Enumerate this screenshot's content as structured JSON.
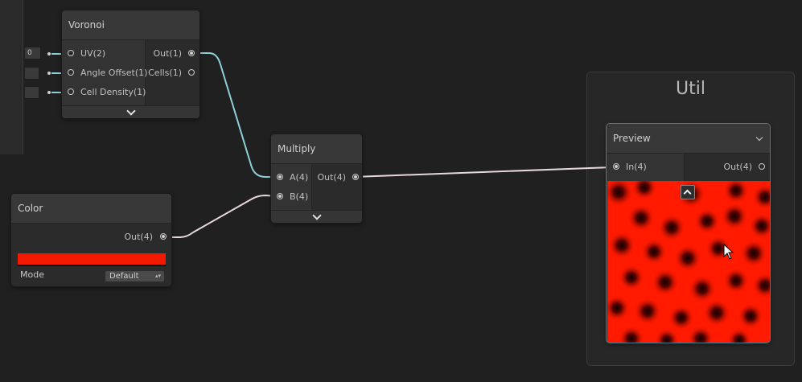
{
  "nodes": {
    "voronoi": {
      "title": "Voronoi",
      "inputs": [
        "UV(2)",
        "Angle Offset(1)",
        "Cell Density(1)"
      ],
      "outputs": [
        "Out(1)",
        "Cells(1)"
      ],
      "uv_field_value": "0"
    },
    "multiply": {
      "title": "Multiply",
      "inputs": [
        "A(4)",
        "B(4)"
      ],
      "outputs": [
        "Out(4)"
      ]
    },
    "color": {
      "title": "Color",
      "output": "Out(4)",
      "swatch_color": "#f21900",
      "mode_label": "Mode",
      "mode_value": "Default"
    },
    "preview": {
      "title": "Preview",
      "input": "In(4)",
      "output": "Out(4)",
      "image_base_color": "#ff1a00"
    }
  },
  "group": {
    "title": "Util"
  },
  "colors": {
    "canvas_bg": "#202020",
    "wire_float": "#8fd0d8",
    "wire_vec4": "#e8d6de",
    "selection_border": "#4a7c8e"
  },
  "icons": {
    "collapse": "chevron-down-icon",
    "expand": "chevron-up-icon",
    "cursor": "mouse-pointer-icon"
  }
}
